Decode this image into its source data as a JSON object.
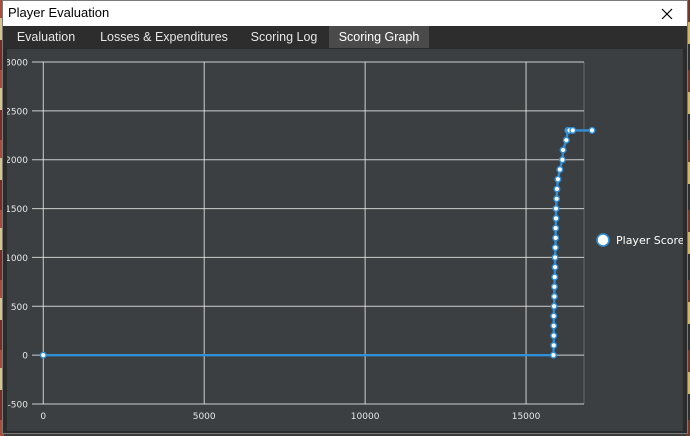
{
  "window": {
    "title": "Player Evaluation"
  },
  "tabs": [
    {
      "label": "Evaluation"
    },
    {
      "label": "Losses & Expenditures"
    },
    {
      "label": "Scoring Log"
    },
    {
      "label": "Scoring Graph",
      "active": true
    }
  ],
  "colors": {
    "series": "#2f8fd8",
    "grid": "#e8e8e8",
    "plot_bg": "#3c3f41"
  },
  "chart_data": {
    "type": "line",
    "title": "",
    "xlabel": "",
    "ylabel": "",
    "xlim": [
      -350,
      16800
    ],
    "ylim": [
      -500,
      3000
    ],
    "x_ticks": [
      0,
      5000,
      10000,
      15000
    ],
    "y_ticks": [
      -500,
      0,
      500,
      1000,
      1500,
      2000,
      2500,
      3000
    ],
    "x_tick_labels": [
      "0",
      "5000",
      "10000",
      "15000"
    ],
    "y_tick_labels": [
      "-500",
      "0",
      "500",
      "1000",
      "1500",
      "2000",
      "2500",
      "3000"
    ],
    "grid": true,
    "legend_position": "right",
    "series": [
      {
        "name": "Player Score",
        "x": [
          0,
          15850,
          15860,
          15860,
          15860,
          15860,
          15870,
          15880,
          15880,
          15890,
          15900,
          15900,
          15910,
          15920,
          15920,
          15930,
          15930,
          15950,
          15960,
          15990,
          16050,
          16130,
          16150,
          16250,
          16300,
          16350,
          16450,
          17050
        ],
        "y": [
          0,
          0,
          100,
          200,
          300,
          400,
          500,
          600,
          700,
          800,
          900,
          1000,
          1100,
          1200,
          1300,
          1400,
          1500,
          1600,
          1700,
          1800,
          1900,
          2000,
          2100,
          2200,
          2300,
          2300,
          2300,
          2300
        ]
      }
    ]
  }
}
